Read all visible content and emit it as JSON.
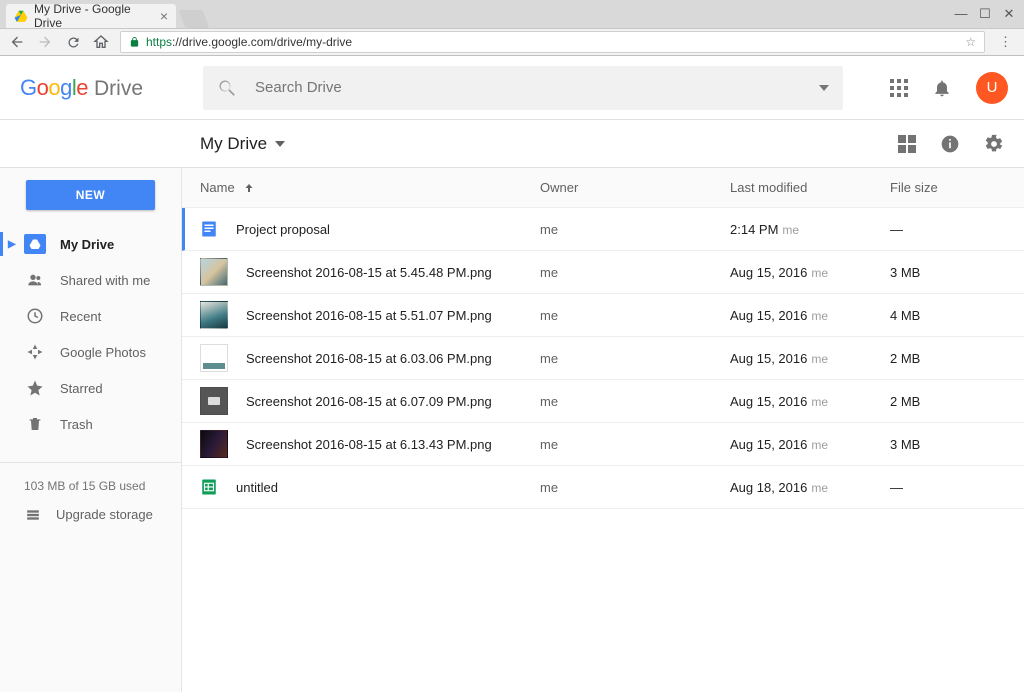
{
  "browser": {
    "tab_title": "My Drive - Google Drive",
    "url_scheme": "https",
    "url_rest": "://drive.google.com/drive/my-drive"
  },
  "header": {
    "logo_drive": "Drive",
    "search_placeholder": "Search Drive",
    "avatar_initial": "U"
  },
  "breadcrumb": {
    "title": "My Drive"
  },
  "sidebar": {
    "new_label": "NEW",
    "items": [
      {
        "label": "My Drive"
      },
      {
        "label": "Shared with me"
      },
      {
        "label": "Recent"
      },
      {
        "label": "Google Photos"
      },
      {
        "label": "Starred"
      },
      {
        "label": "Trash"
      }
    ],
    "storage_text": "103 MB of 15 GB used",
    "upgrade_label": "Upgrade storage"
  },
  "columns": {
    "name": "Name",
    "owner": "Owner",
    "modified": "Last modified",
    "size": "File size"
  },
  "files": [
    {
      "name": "Project proposal",
      "owner": "me",
      "modified": "2:14 PM",
      "modified_by": "me",
      "size": "—",
      "type": "doc"
    },
    {
      "name": "Screenshot 2016-08-15 at 5.45.48 PM.png",
      "owner": "me",
      "modified": "Aug 15, 2016",
      "modified_by": "me",
      "size": "3 MB",
      "type": "img1"
    },
    {
      "name": "Screenshot 2016-08-15 at 5.51.07 PM.png",
      "owner": "me",
      "modified": "Aug 15, 2016",
      "modified_by": "me",
      "size": "4 MB",
      "type": "img2"
    },
    {
      "name": "Screenshot 2016-08-15 at 6.03.06 PM.png",
      "owner": "me",
      "modified": "Aug 15, 2016",
      "modified_by": "me",
      "size": "2 MB",
      "type": "img3"
    },
    {
      "name": "Screenshot 2016-08-15 at 6.07.09 PM.png",
      "owner": "me",
      "modified": "Aug 15, 2016",
      "modified_by": "me",
      "size": "2 MB",
      "type": "img4"
    },
    {
      "name": "Screenshot 2016-08-15 at 6.13.43 PM.png",
      "owner": "me",
      "modified": "Aug 15, 2016",
      "modified_by": "me",
      "size": "3 MB",
      "type": "img5"
    },
    {
      "name": "untitled",
      "owner": "me",
      "modified": "Aug 18, 2016",
      "modified_by": "me",
      "size": "—",
      "type": "sheet"
    }
  ]
}
